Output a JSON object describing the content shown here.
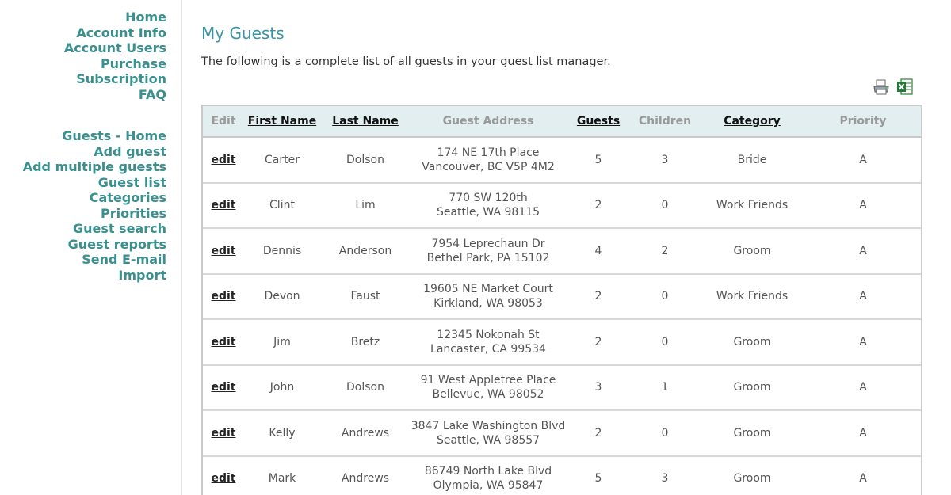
{
  "sidebar": {
    "primary": [
      {
        "label": "Home"
      },
      {
        "label": "Account Info"
      },
      {
        "label": "Account Users"
      },
      {
        "label": "Purchase"
      },
      {
        "label": "Subscription"
      },
      {
        "label": "FAQ"
      }
    ],
    "guests": [
      {
        "label": "Guests - Home"
      },
      {
        "label": "Add guest"
      },
      {
        "label": "Add multiple guests"
      },
      {
        "label": "Guest list"
      },
      {
        "label": "Categories"
      },
      {
        "label": "Priorities"
      },
      {
        "label": "Guest search"
      },
      {
        "label": "Guest reports"
      },
      {
        "label": "Send E-mail"
      },
      {
        "label": "Import"
      }
    ]
  },
  "main": {
    "title": "My Guests",
    "intro": "The following is a complete list of all guests in your guest list manager.",
    "toolbar_icons": [
      "printer-icon",
      "excel-export-icon"
    ]
  },
  "table": {
    "columns": [
      "Edit",
      "First Name",
      "Last Name",
      "Guest Address",
      "Guests",
      "Children",
      "Category",
      "Priority"
    ],
    "edit_label": "edit",
    "rows": [
      {
        "first": "Carter",
        "last": "Dolson",
        "addr1": "174 NE 17th Place",
        "addr2": "Vancouver, BC V5P 4M2",
        "guests": "5",
        "children": "3",
        "category": "Bride",
        "priority": "A"
      },
      {
        "first": "Clint",
        "last": "Lim",
        "addr1": "770 SW 120th",
        "addr2": "Seattle, WA 98115",
        "guests": "2",
        "children": "0",
        "category": "Work Friends",
        "priority": "A"
      },
      {
        "first": "Dennis",
        "last": "Anderson",
        "addr1": "7954 Leprechaun Dr",
        "addr2": "Bethel Park, PA 15102",
        "guests": "4",
        "children": "2",
        "category": "Groom",
        "priority": "A"
      },
      {
        "first": "Devon",
        "last": "Faust",
        "addr1": "19605 NE Market Court",
        "addr2": "Kirkland, WA 98053",
        "guests": "2",
        "children": "0",
        "category": "Work Friends",
        "priority": "A"
      },
      {
        "first": "Jim",
        "last": "Bretz",
        "addr1": "12345 Nokonah St",
        "addr2": "Lancaster, CA 99534",
        "guests": "2",
        "children": "0",
        "category": "Groom",
        "priority": "A"
      },
      {
        "first": "John",
        "last": "Dolson",
        "addr1": "91 West Appletree Place",
        "addr2": "Bellevue, WA 98052",
        "guests": "3",
        "children": "1",
        "category": "Groom",
        "priority": "A"
      },
      {
        "first": "Kelly",
        "last": "Andrews",
        "addr1": "3847 Lake Washington Blvd",
        "addr2": "Seattle, WA 98557",
        "guests": "2",
        "children": "0",
        "category": "Groom",
        "priority": "A"
      },
      {
        "first": "Mark",
        "last": "Andrews",
        "addr1": "86749 North Lake Blvd",
        "addr2": "Olympia, WA 95847",
        "guests": "5",
        "children": "3",
        "category": "Groom",
        "priority": "A"
      }
    ]
  },
  "colors": {
    "nav_link": "#3a8f8f",
    "title": "#3a93a3",
    "header_bg": "#e3eef0"
  }
}
